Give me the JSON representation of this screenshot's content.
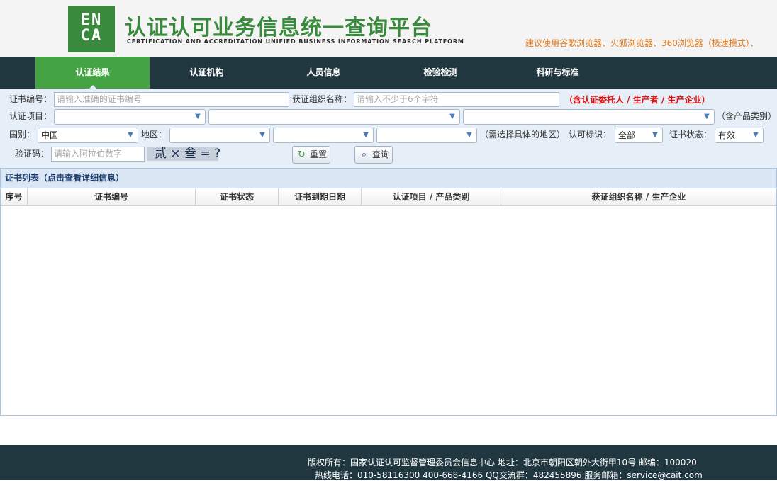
{
  "header": {
    "logo_text": "ENCA",
    "title": "认证认可业务信息统一查询平台",
    "subtitle": "CERTIFICATION AND ACCREDITATION UNIFIED BUSINESS INFORMATION SEARCH PLATFORM",
    "browser_tip": "建议使用谷歌浏览器、火狐浏览器、360浏览器（极速模式）、"
  },
  "nav": {
    "items": [
      {
        "label": "认证结果",
        "active": true
      },
      {
        "label": "认证机构",
        "active": false
      },
      {
        "label": "人员信息",
        "active": false
      },
      {
        "label": "检验检测",
        "active": false
      },
      {
        "label": "科研与标准",
        "active": false
      }
    ]
  },
  "form": {
    "cert_no_label": "证书编号：",
    "cert_no_placeholder": "请输入准确的证书编号",
    "org_name_label": "获证组织名称：",
    "org_name_placeholder": "请输入不少于6个字符",
    "org_note": "（含认证委托人 / 生产者 / 生产企业）",
    "cert_item_label": "认证项目：",
    "cert_item_1": "",
    "cert_item_2": "",
    "cert_item_3": "",
    "product_note": "（含产品类别）",
    "country_label": "国别：",
    "country_value": "中国",
    "region_label": "地区：",
    "region_1": "",
    "region_2": "",
    "region_3": "",
    "region_note": "（需选择具体的地区）",
    "accred_label": "认可标识：",
    "accred_value": "全部",
    "status_label": "证书状态：",
    "status_value": "有效",
    "captcha_label": "验证码：",
    "captcha_placeholder": "请输入阿拉伯数字",
    "captcha_text": "贰 × 叁 = ?",
    "reset_label": "重置",
    "query_label": "查询"
  },
  "list": {
    "title": "证书列表（点击查看详细信息）",
    "columns": [
      "序号",
      "证书编号",
      "证书状态",
      "证书到期日期",
      "认证项目 / 产品类别",
      "获证组织名称 / 生产企业"
    ]
  },
  "footer": {
    "line1": "版权所有：国家认证认可监督管理委员会信息中心    地址：北京市朝阳区朝外大街甲10号     邮编：100020",
    "line2": "热线电话：010-58116300  400-668-4166     QQ交流群：482455896     服务邮箱：service@cait.com"
  },
  "colors": {
    "brand_green": "#44a342",
    "nav_bg": "#213740",
    "form_bg": "#e6eef7",
    "note_red": "#dd1111",
    "tip_orange": "#e07a1a"
  }
}
